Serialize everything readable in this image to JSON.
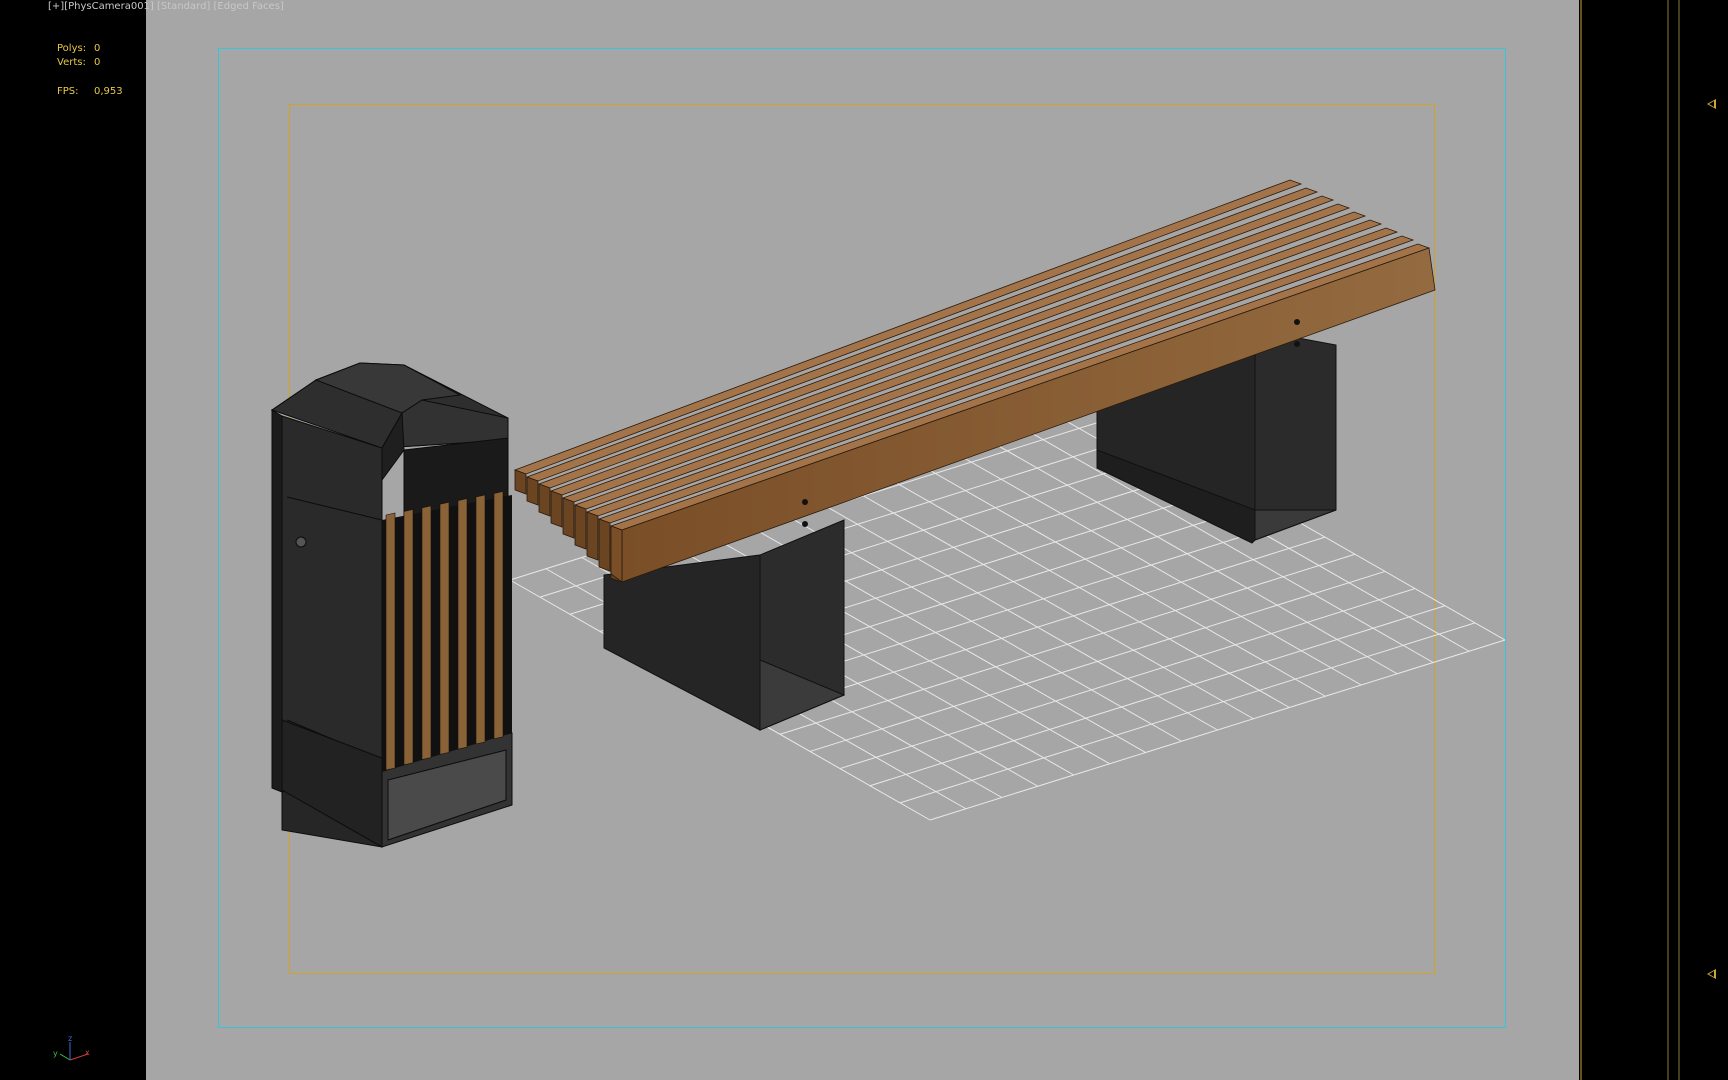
{
  "viewport": {
    "label_parts": [
      "[+]",
      "[PhysCamera001]",
      "[Standard]",
      "[Edged Faces]"
    ],
    "label_sep": " "
  },
  "stats": {
    "polys_label": "Polys:",
    "polys_value": "0",
    "verts_label": "Verts:",
    "verts_value": "0",
    "fps_label": "FPS:",
    "fps_value": "0,953"
  },
  "axis_gizmo": {
    "x": "x",
    "y": "y",
    "z": "z"
  },
  "colors": {
    "viewport_bg": "#a6a6a6",
    "safe_frame_outer": "#37c4d4",
    "safe_frame_inner": "#d2a227",
    "stats_text": "#e6c84a",
    "wood": "#8c5f35",
    "metal": "#2a2a2a"
  },
  "scene": {
    "objects": [
      "bench",
      "trash-bin",
      "ground-grid"
    ]
  }
}
